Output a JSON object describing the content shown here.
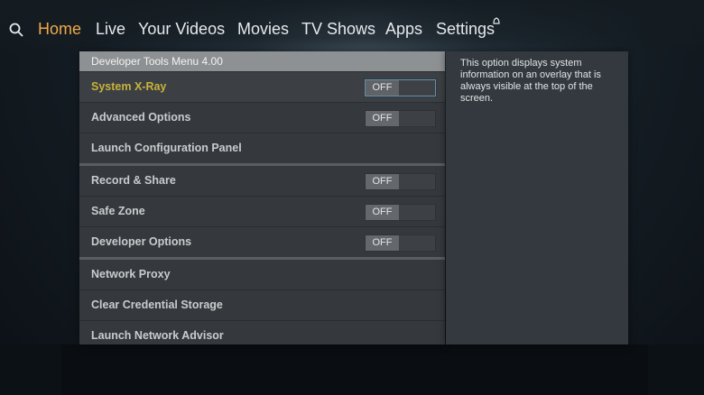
{
  "nav": {
    "items": [
      "Home",
      "Live",
      "Your Videos",
      "Movies",
      "TV Shows",
      "Apps",
      "Settings"
    ],
    "active_index": 0,
    "accent_color": "#f0a94a",
    "search_icon": "search-icon"
  },
  "panel": {
    "title": "Developer Tools Menu 4.00",
    "rows": [
      {
        "label": "System X-Ray",
        "toggle": "OFF",
        "selected": true
      },
      {
        "label": "Advanced Options",
        "toggle": "OFF"
      },
      {
        "label": "Launch Configuration Panel"
      },
      {
        "label": "Record & Share",
        "toggle": "OFF"
      },
      {
        "label": "Safe Zone",
        "toggle": "OFF"
      },
      {
        "label": "Developer Options",
        "toggle": "OFF"
      },
      {
        "label": "Network Proxy"
      },
      {
        "label": "Clear Credential Storage"
      },
      {
        "label": "Launch Network Advisor"
      }
    ],
    "selected_color": "#c9b23a"
  },
  "description": {
    "text": "This option displays system information on an overlay that is always visible at the top of the screen."
  }
}
